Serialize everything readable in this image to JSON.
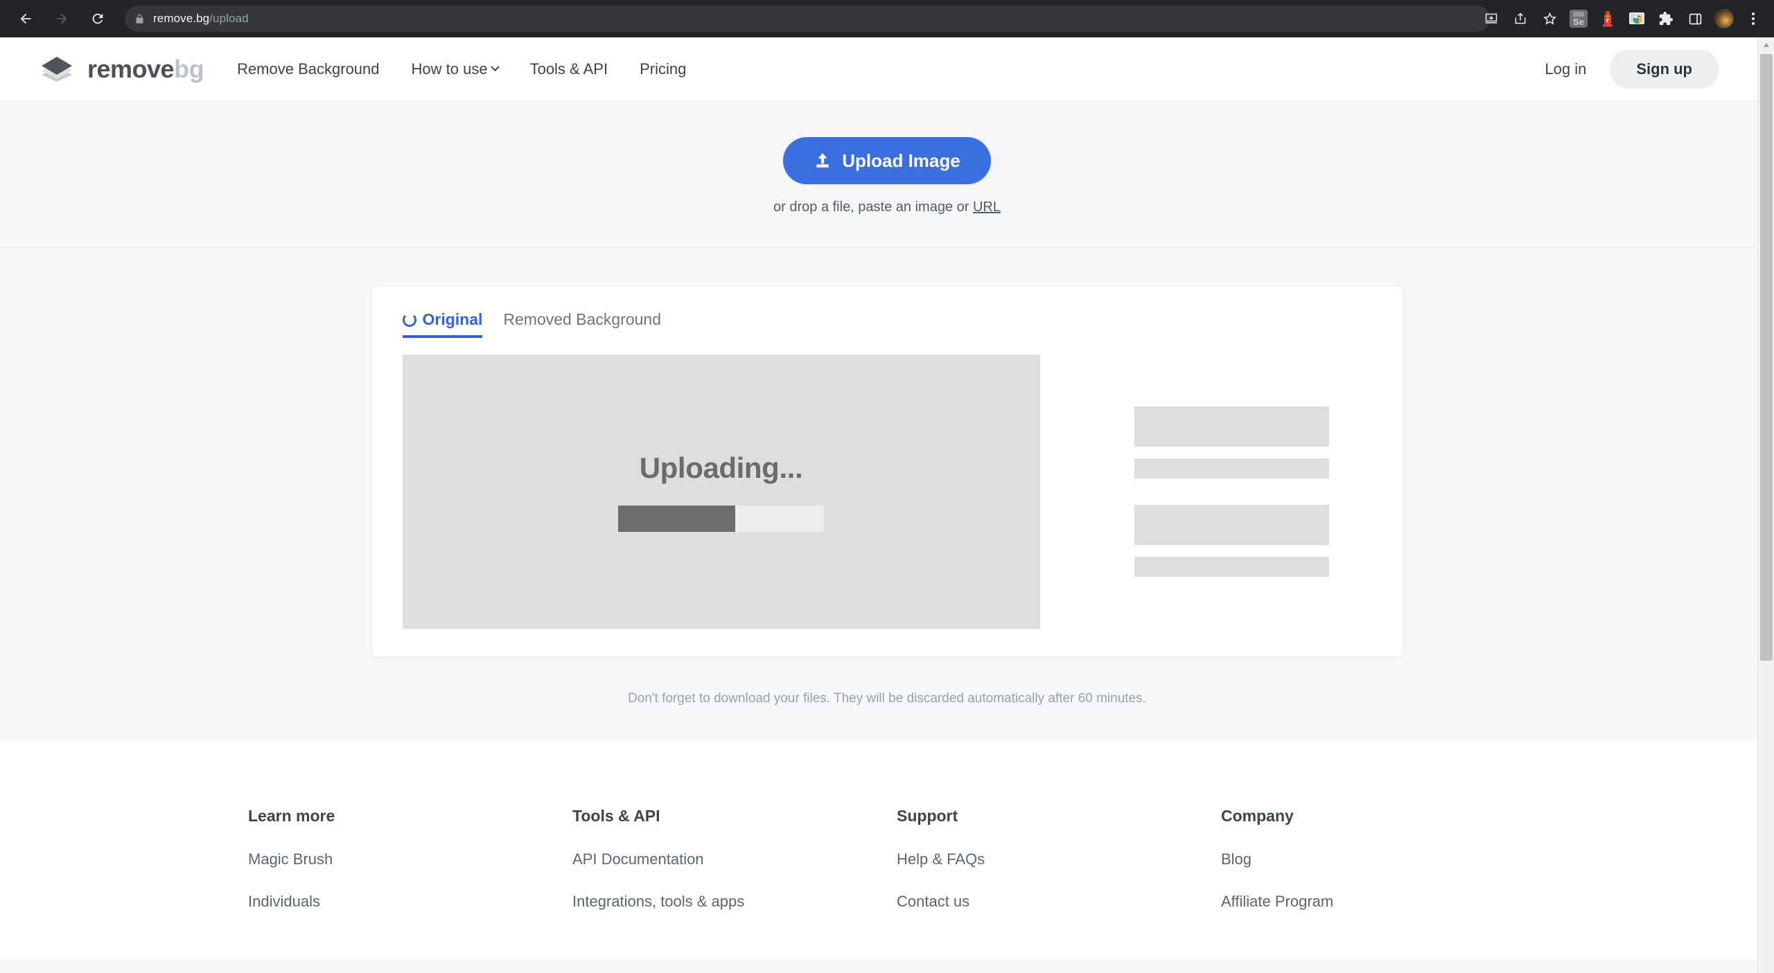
{
  "browser": {
    "back_label": "back-arrow",
    "forward_label": "forward-arrow",
    "reload_label": "reload",
    "url_host": "remove.bg",
    "url_path": "/upload",
    "extension_se_label": "Se",
    "toolbar_icons": [
      "install-app-icon",
      "share-icon",
      "bookmark-star-icon",
      "selenium-extension-icon",
      "hydrant-extension-icon",
      "chrome-image-extension-icon",
      "extensions-puzzle-icon",
      "side-panel-icon",
      "profile-avatar",
      "browser-menu-icon"
    ]
  },
  "header": {
    "logo_primary": "remove",
    "logo_secondary": "bg",
    "nav": [
      {
        "label": "Remove Background",
        "has_chevron": false
      },
      {
        "label": "How to use",
        "has_chevron": true
      },
      {
        "label": "Tools & API",
        "has_chevron": false
      },
      {
        "label": "Pricing",
        "has_chevron": false
      }
    ],
    "login_label": "Log in",
    "signup_label": "Sign up"
  },
  "hero": {
    "upload_button_label": "Upload Image",
    "drop_hint_prefix": "or drop a file, paste an image or ",
    "drop_hint_link": "URL"
  },
  "card": {
    "tabs": [
      {
        "label": "Original",
        "active": true
      },
      {
        "label": "Removed Background",
        "active": false
      }
    ],
    "preview": {
      "status_text": "Uploading...",
      "progress_percent": 57
    },
    "skeleton_count": 4
  },
  "notice": "Don't forget to download your files. They will be discarded automatically after 60 minutes.",
  "footer": {
    "columns": [
      {
        "title": "Learn more",
        "links": [
          "Magic Brush",
          "Individuals"
        ]
      },
      {
        "title": "Tools & API",
        "links": [
          "API Documentation",
          "Integrations, tools & apps"
        ]
      },
      {
        "title": "Support",
        "links": [
          "Help & FAQs",
          "Contact us"
        ]
      },
      {
        "title": "Company",
        "links": [
          "Blog",
          "Affiliate Program"
        ]
      }
    ]
  },
  "colors": {
    "accent_blue": "#3b6fe0",
    "tab_blue": "#2f62dd",
    "page_bg": "#f6f7f8",
    "skeleton_gray": "#dcdee0",
    "progress_fill": "#6e6e6e"
  }
}
